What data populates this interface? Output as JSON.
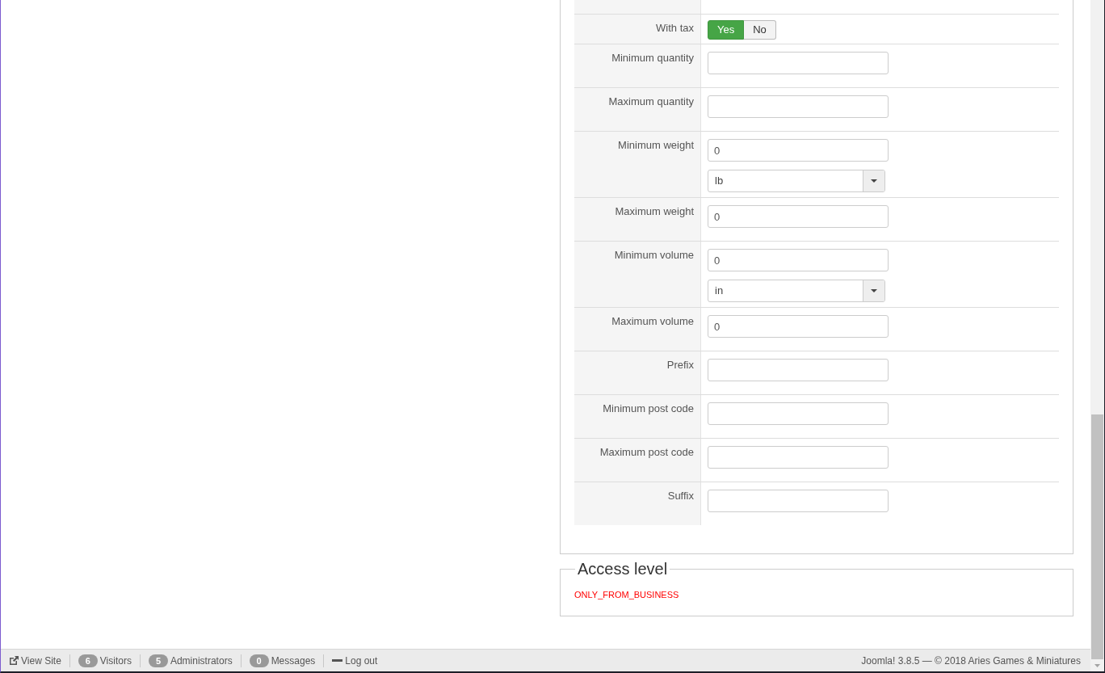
{
  "form_rows": [
    {
      "label": "With tax",
      "kind": "toggle",
      "options": [
        {
          "label": "Yes",
          "selected": true
        },
        {
          "label": "No",
          "selected": false
        }
      ]
    },
    {
      "label": "Minimum quantity",
      "kind": "input"
    },
    {
      "label": "Maximum quantity",
      "kind": "input"
    },
    {
      "label": "Minimum weight",
      "kind": "input_select",
      "value": "0",
      "select": "lb"
    },
    {
      "label": "Maximum weight",
      "kind": "input",
      "value": "0"
    },
    {
      "label": "Minimum volume",
      "kind": "input_select",
      "value": "0",
      "select": "in"
    },
    {
      "label": "Maximum volume",
      "kind": "input",
      "value": "0"
    },
    {
      "label": "Prefix",
      "kind": "input"
    },
    {
      "label": "Minimum post code",
      "kind": "input"
    },
    {
      "label": "Maximum post code",
      "kind": "input"
    },
    {
      "label": "Suffix",
      "kind": "input"
    }
  ],
  "access_level": {
    "legend": "Access level",
    "text": "ONLY_FROM_BUSINESS"
  },
  "status_bar": {
    "items": [
      {
        "kind": "external",
        "label": "View Site"
      },
      {
        "kind": "count",
        "count": "6",
        "label": "Visitors"
      },
      {
        "kind": "count",
        "count": "5",
        "label": "Administrators"
      },
      {
        "kind": "count",
        "count": "0",
        "label": "Messages"
      },
      {
        "kind": "logout",
        "label": "Log out"
      }
    ],
    "copyright": "Joomla! 3.8.5 — © 2018 Aries Games & Miniatures"
  }
}
